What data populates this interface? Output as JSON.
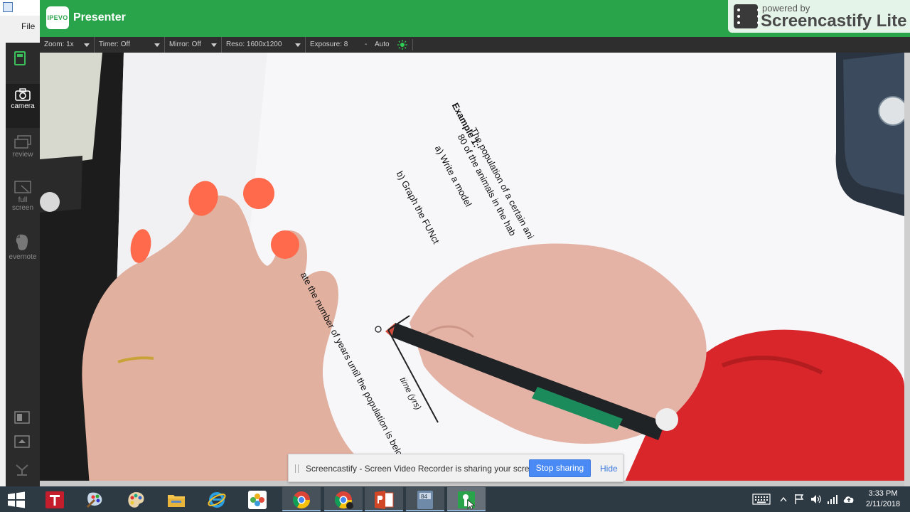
{
  "background_window": {
    "menu_file": "File"
  },
  "header": {
    "logo_text": "IPEVO",
    "app_title": "Presenter",
    "watermark_powered": "powered by",
    "watermark_brand": "Screencastify Lite"
  },
  "toolbar": {
    "zoom": "Zoom: 1x",
    "timer": "Timer: Off",
    "mirror": "Mirror: Off",
    "resolution": "Reso: 1600x1200",
    "exposure": "Exposure: 8",
    "exposure_dash": "-",
    "auto": "Auto"
  },
  "sidebar": {
    "items": [
      {
        "label": "camera",
        "active": true
      },
      {
        "label": "review",
        "active": false
      },
      {
        "label": "full screen",
        "active": false
      },
      {
        "label": "evernote",
        "active": false
      }
    ]
  },
  "paper_text": {
    "example_heading": "Example 1:",
    "line_population": "The population of a certain ani",
    "line_animals": "80 of the animals in the hab",
    "part_a": "a)  Write a model",
    "part_b": "b)  Graph the FUNct",
    "estimate": "ate the number of years until the population is below",
    "axis_origin": "0",
    "axis_time": "time (yrs)"
  },
  "notification": {
    "message": "Screencastify - Screen Video Recorder is sharing your screen.",
    "stop_label": "Stop sharing",
    "hide_label": "Hide"
  },
  "taskbar": {
    "apps": [
      "text-app",
      "paint-app",
      "paint-palette-app",
      "file-explorer",
      "internet-explorer",
      "photos",
      "chrome",
      "chrome-profile",
      "powerpoint",
      "ti84-emulator",
      "ipevo-presenter"
    ],
    "calculator_badge": "84",
    "time": "3:33 PM",
    "date": "2/11/2018"
  },
  "colors": {
    "header_green": "#2aa44a",
    "stop_button_blue": "#4a8af4",
    "taskbar": "#2d3a44"
  }
}
